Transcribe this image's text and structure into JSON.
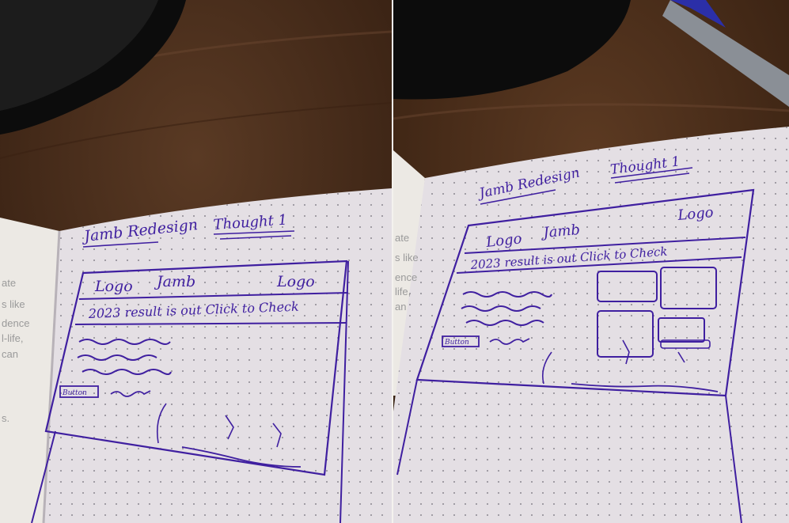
{
  "left_photo": {
    "title": "Jamb Redesign",
    "thought_label": "Thought 1",
    "navbar": {
      "logo_left": "Logo",
      "nav_center": "Jamb",
      "logo_right": "Logo"
    },
    "banner": "2023 result is out Click to Check",
    "button_label": "Button",
    "book_page_fragments": [
      "ate",
      "s like",
      "dence",
      "l-life,",
      "can",
      "s."
    ]
  },
  "right_photo": {
    "title": "Jamb Redesign",
    "thought_label": "Thought 1",
    "navbar": {
      "logo_left": "Logo",
      "nav_center": "Jamb",
      "logo_right": "Logo"
    },
    "banner": "2023 result is out Click to Check",
    "button_label": "Button",
    "book_page_fragments": [
      "ate",
      "s like",
      "ence",
      "life,",
      "an"
    ]
  },
  "colors": {
    "ink": "#3f1fa0",
    "paper": "#e4dfe4",
    "desk": "#4a2e1c",
    "pen_barrel": "#8a8f96",
    "pen_cap": "#2b2fa8"
  }
}
